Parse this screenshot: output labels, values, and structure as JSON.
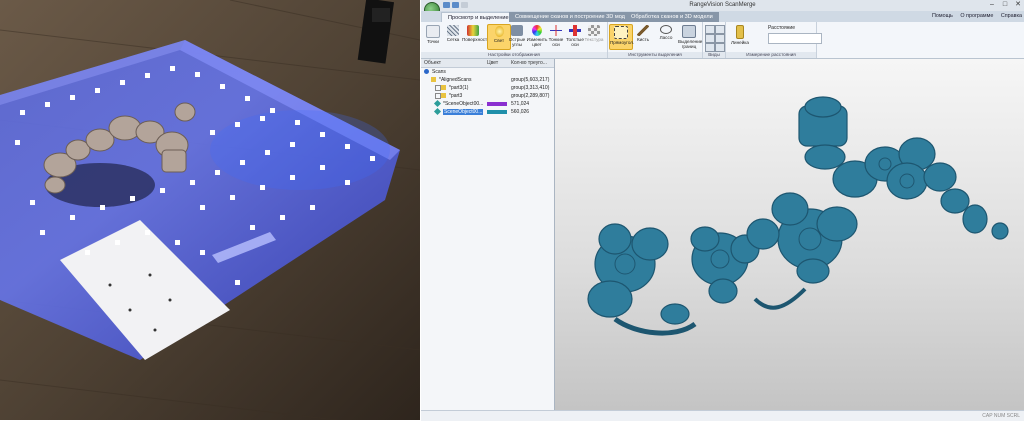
{
  "window": {
    "title": "RangeVision ScanMerge",
    "minimize_label": "–",
    "maximize_label": "□",
    "close_label": "✕"
  },
  "tabs": [
    {
      "label": "Просмотр и выделение",
      "active": true
    },
    {
      "label": "Совмещение сканов и построение 3D модели",
      "active": false
    },
    {
      "label": "Обработка сканов и 3D модели",
      "active": false
    }
  ],
  "menu_links": [
    "Помощь",
    "О программе",
    "Справка"
  ],
  "ribbon": {
    "group1_label": "Настройки отображения",
    "group1_buttons": [
      "Точки",
      "Сетка",
      "Поверхность",
      "Свет",
      "Острые углы",
      "Изменить цвет",
      "Тонкие оси",
      "Толстые оси",
      "Текстура"
    ],
    "group2_label": "Инструменты выделения",
    "group2_buttons": [
      "Прямоугол.",
      "Кисть",
      "Лассо",
      "Выделение границ"
    ],
    "group3_label": "Виды",
    "group4_label": "Измерение расстояния",
    "ruler_label": "Линейка",
    "distance_label": "Расстояние"
  },
  "tree": {
    "columns": [
      "Объект",
      "Цвет",
      "Кол-во треуго..."
    ],
    "rows": [
      {
        "name": "Scans",
        "count": "",
        "color": ""
      },
      {
        "name": "*AlignedScans",
        "count": "group(5,603,217)",
        "color": ""
      },
      {
        "name": "*part3(1)",
        "count": "group(3,313,410)",
        "color": ""
      },
      {
        "name": "*part3",
        "count": "group(2,289,807)",
        "color": ""
      },
      {
        "name": "*SceneObject00...",
        "count": "571,024",
        "color": "#8a2fd0"
      },
      {
        "name": "SceneObject00...",
        "count": "560,026",
        "color": "#1f8faa"
      }
    ]
  },
  "status": {
    "text": "CAP NUM SCRL"
  },
  "colors": {
    "model": "#2f7d9c",
    "selection": "#fbd46a",
    "ribbon_bg": "#f3f6fa"
  }
}
